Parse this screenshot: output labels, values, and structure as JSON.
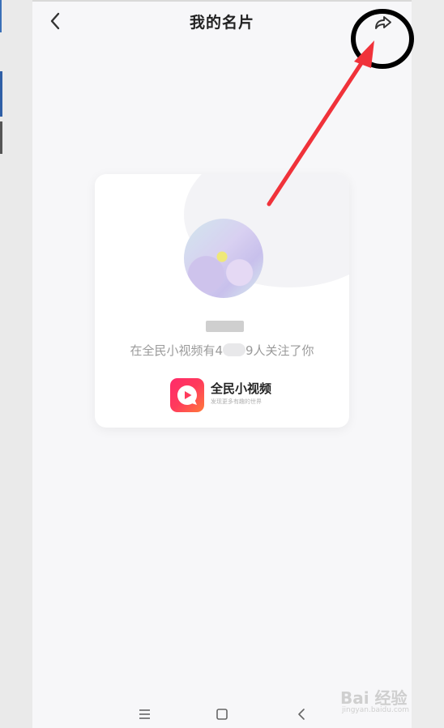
{
  "header": {
    "title": "我的名片"
  },
  "card": {
    "follow_prefix": "在全民小视频有4",
    "follow_suffix": "9人关注了你",
    "brand": {
      "name": "全民小视频",
      "slogan": "发现更多有趣的世界"
    }
  },
  "navbar": {
    "items": [
      "menu-icon",
      "home-icon",
      "back-icon"
    ]
  },
  "watermark": {
    "main": "Bai 经验",
    "sub": "jingyan.baidu.com"
  },
  "colors": {
    "annotation_red": "#f0323a",
    "brand_gradient_start": "#ff2a6a",
    "brand_gradient_end": "#ff7a3a"
  }
}
